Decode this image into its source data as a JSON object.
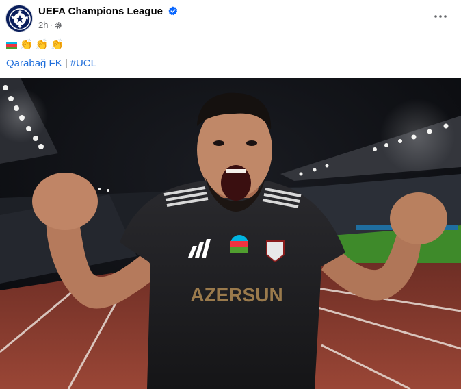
{
  "page": {
    "name": "UEFA Champions League",
    "verified": true,
    "time": "2h",
    "audience_icon": "gear-icon",
    "more_icon": "more-horizontal-icon"
  },
  "caption": {
    "flag": "azerbaijan-flag",
    "emojis": [
      "👏",
      "👏",
      "👏"
    ]
  },
  "tags": {
    "team": "Qarabağ FK",
    "separator": "|",
    "hashtag": "#UCL"
  },
  "photo": {
    "jersey_sponsor": "AZERSUN",
    "description_icon": "celebrating-player-photo"
  },
  "colors": {
    "link": "#216fdb",
    "verified": "#0866ff",
    "meta": "#65676b",
    "track": "#8a3b2e",
    "pitch": "#3e8a2a"
  }
}
